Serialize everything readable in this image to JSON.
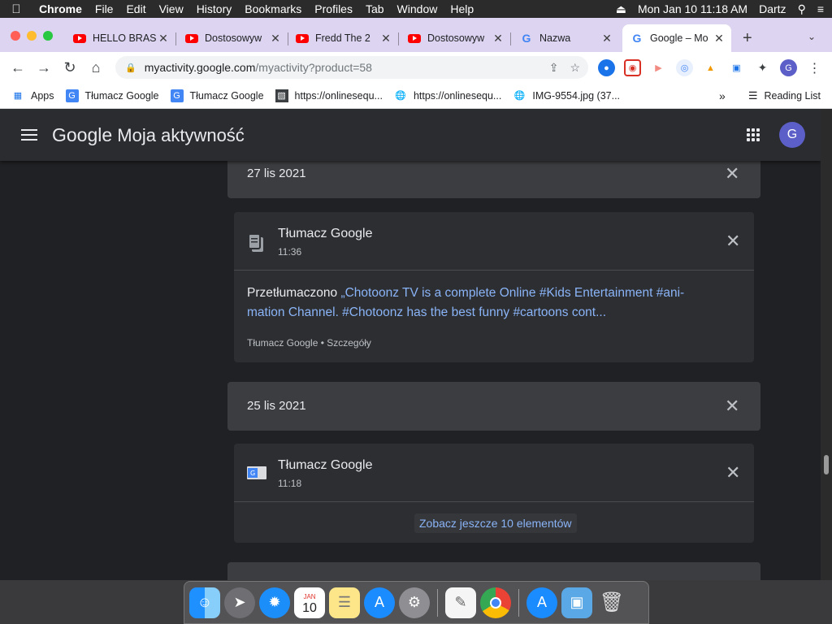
{
  "menubar": {
    "app": "Chrome",
    "items": [
      "File",
      "Edit",
      "View",
      "History",
      "Bookmarks",
      "Profiles",
      "Tab",
      "Window",
      "Help"
    ],
    "datetime": "Mon Jan 10  11:18 AM",
    "user": "Dartz"
  },
  "tabs": [
    {
      "title": "HELLO BRAS",
      "icon": "youtube-icon"
    },
    {
      "title": "Dostosowyw",
      "icon": "youtube-icon"
    },
    {
      "title": "Fredd The 2",
      "icon": "youtube-icon"
    },
    {
      "title": "Dostosowyw",
      "icon": "youtube-icon"
    },
    {
      "title": "Nazwa",
      "icon": "google-icon"
    },
    {
      "title": "Google – Mo",
      "icon": "google-icon",
      "active": true
    }
  ],
  "omnibox": {
    "host": "myactivity.google.com",
    "path": "/myactivity?product=58"
  },
  "bookmarks": [
    {
      "label": "Apps",
      "icon": "apps-grid-icon"
    },
    {
      "label": "Tłumacz Google",
      "icon": "google-translate-icon"
    },
    {
      "label": "Tłumacz Google",
      "icon": "google-translate-icon"
    },
    {
      "label": "https://onlinesequ...",
      "icon": "site-icon"
    },
    {
      "label": "https://onlinesequ...",
      "icon": "globe-icon"
    },
    {
      "label": "IMG-9554.jpg (37...",
      "icon": "globe-icon"
    }
  ],
  "reading_list": "Reading List",
  "appbar": {
    "brand": "Google",
    "title": "Moja aktywność",
    "avatar_letter": "G"
  },
  "activity": {
    "day1": {
      "date": "27 lis 2021",
      "card": {
        "product": "Tłumacz Google",
        "time": "11:36",
        "action": "Przetłumaczono",
        "text": "„Chotoonz TV is a complete Online #Kids Entertainment #ani-",
        "text2": "mation Channel. #Chotoonz has the best funny #cartoons cont...",
        "meta": "Tłumacz Google • Szczegóły"
      }
    },
    "day2": {
      "date": "25 lis 2021",
      "card": {
        "product": "Tłumacz Google",
        "time": "11:18",
        "show_more": "Zobacz jeszcze 10 elementów"
      }
    }
  },
  "dock": {
    "calendar_month": "JAN",
    "calendar_day": "10"
  }
}
